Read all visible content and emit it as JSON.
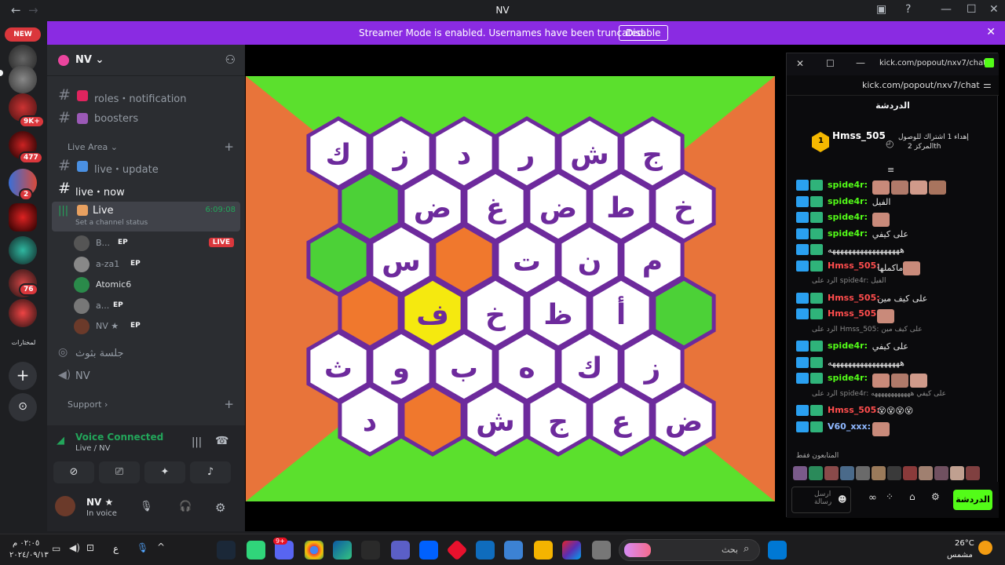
{
  "titlebar": {
    "title": "NV",
    "back_icon": "arrow-left-icon",
    "forward_icon": "arrow-right-icon"
  },
  "banner": {
    "text": "Streamer Mode is enabled. Usernames have been truncated.",
    "button": "Disable",
    "color": "#8a2be2"
  },
  "servers": {
    "new_label": "NEW",
    "badges": [
      "9K+",
      "477",
      "2",
      "76"
    ],
    "text_server": "لمختارات"
  },
  "guild": {
    "name": "NV",
    "channels_top": [
      {
        "label": "roles・notification"
      },
      {
        "label": "boosters"
      }
    ],
    "category_live": "Live Area",
    "channels_live": [
      {
        "label": "live・update"
      },
      {
        "label": "live・now"
      }
    ],
    "voice_live": {
      "name": "Live",
      "time": "6:09:08",
      "status": "Set a channel status"
    },
    "voice_users": [
      {
        "name": "B...",
        "ep": "EP",
        "live": "LIVE"
      },
      {
        "name": "a-za1",
        "ep": "EP"
      },
      {
        "name": "Atomic6",
        "ep": ""
      },
      {
        "name": "a...",
        "ep": "EP"
      },
      {
        "name": "NV ★",
        "ep": "EP"
      }
    ],
    "voice_other": [
      {
        "label": "جلسة بثوث"
      },
      {
        "label": "NV"
      }
    ],
    "category_support": "Support"
  },
  "voice_panel": {
    "status": "Voice Connected",
    "sub": "Live / NV",
    "user_name": "NV ★",
    "user_state": "In voice"
  },
  "game": {
    "rows": [
      [
        "ك",
        "ز",
        "د",
        "ر",
        "ش",
        "ج"
      ],
      [
        "",
        "ض",
        "غ",
        "ض",
        "ط",
        "خ"
      ],
      [
        "",
        "س",
        "",
        "ت",
        "ن",
        "م"
      ],
      [
        "",
        "ف",
        "خ",
        "ظ",
        "أ",
        ""
      ],
      [
        "ث",
        "و",
        "ب",
        "ه",
        "ك",
        "ز"
      ],
      [
        "د",
        "",
        "ش",
        "ج",
        "ع",
        "ض"
      ]
    ],
    "colors": {
      "bg_orange": "#e8743a",
      "bg_green": "#5be02d",
      "tile_white": "#ffffff",
      "tile_green": "#4cd137",
      "tile_orange": "#f0782d",
      "tile_yellow": "#f5e90f",
      "border_purple": "#6d2a9c"
    }
  },
  "chat": {
    "popout_title": "kick.com/popout/nxv7/chat...",
    "url": "kick.com/popout/nxv7/chat",
    "heading": "الدردشة",
    "pinned": {
      "user": "Hmss_505",
      "count": "1",
      "rank_text": "إهداء 1 اشتراك للوصول",
      "rank_sub": "المركز 2th"
    },
    "messages": [
      {
        "user": "spide4r:",
        "text": "",
        "color": "#53fc18",
        "emotes": 4
      },
      {
        "user": "spide4r:",
        "text": "الفيل",
        "color": "#53fc18",
        "emotes": 0
      },
      {
        "user": "spide4r:",
        "text": "",
        "color": "#53fc18",
        "emotes": 1
      },
      {
        "user": "spide4r:",
        "text": "على كيفي",
        "color": "#53fc18",
        "emotes": 0
      },
      {
        "user": "",
        "text": "ههههههههههههههههههه",
        "color": "#53fc18",
        "emotes": 0
      },
      {
        "user": "Hmss_505:",
        "text": "ماكملها",
        "color": "#ff4d4d",
        "emotes": 1
      },
      {
        "reply": "الرد على spide4r: الفيل"
      },
      {
        "user": "Hmss_505:",
        "text": "على كيف مين",
        "color": "#ff4d4d",
        "emotes": 0
      },
      {
        "user": "Hmss_505:",
        "text": "",
        "color": "#ff4d4d",
        "emotes": 1
      },
      {
        "reply": "الرد على Hmss_505: على كيف مين"
      },
      {
        "user": "spide4r:",
        "text": "على كيفي",
        "color": "#53fc18",
        "emotes": 0
      },
      {
        "user": "",
        "text": "ههههههههههههههههههه",
        "color": "#53fc18",
        "emotes": 0
      },
      {
        "user": "spide4r:",
        "text": "",
        "color": "#53fc18",
        "emotes": 3
      },
      {
        "reply": "الرد على spide4r: على كيفي ههههههههههههه"
      },
      {
        "user": "Hmss_505:",
        "text": "😵😵😵😵",
        "color": "#ff4d4d",
        "emotes": 0
      },
      {
        "user": "V60_xxx:",
        "text": "",
        "color": "#8fb8ff",
        "emotes": 1
      }
    ],
    "supporters_label": "المتابعون فقط",
    "send": "الدردشة",
    "input_placeholder": "ارسل رسالة"
  },
  "taskbar": {
    "time": "٠٢:٠٥ م",
    "date": "٢٠٢٤/٠٩/١٣",
    "lang": "ع",
    "search": "بحث",
    "temp": "26°C",
    "weather": "مشمس",
    "notification_count": "9+"
  }
}
